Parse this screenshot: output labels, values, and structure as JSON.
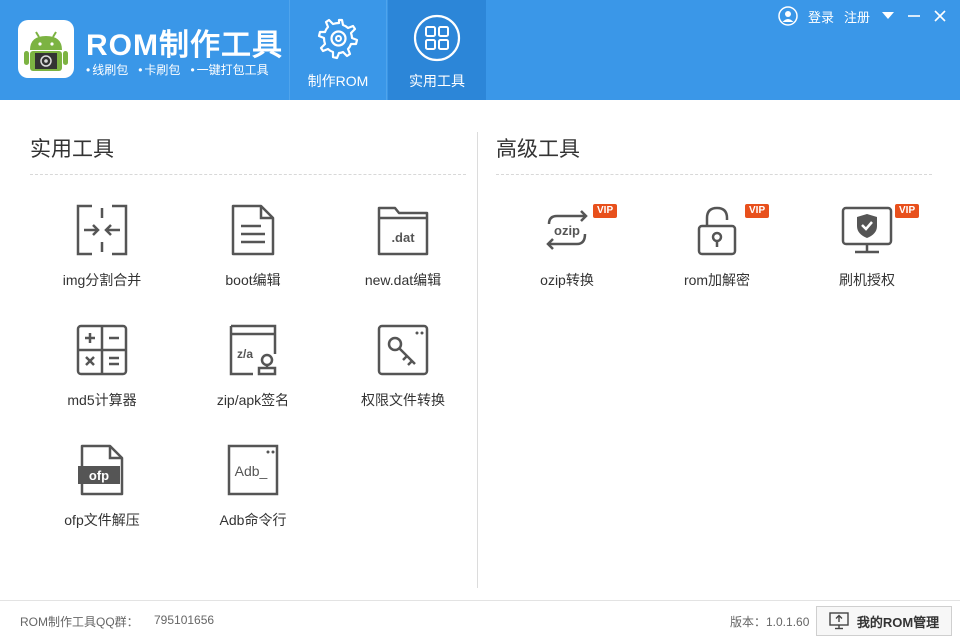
{
  "header": {
    "app_title": "ROM制作工具",
    "features": [
      "线刷包",
      "卡刷包",
      "一键打包工具"
    ],
    "tabs": [
      {
        "label": "制作ROM",
        "icon": "gear-icon"
      },
      {
        "label": "实用工具",
        "icon": "grid-icon"
      }
    ],
    "login": "登录",
    "register": "注册"
  },
  "left_section": {
    "title": "实用工具",
    "tools": [
      {
        "label": "img分割合并",
        "icon": "split-merge-icon"
      },
      {
        "label": "boot编辑",
        "icon": "document-icon"
      },
      {
        "label": "new.dat编辑",
        "icon": "dat-folder-icon",
        "icon_text": ".dat"
      },
      {
        "label": "md5计算器",
        "icon": "calculator-icon"
      },
      {
        "label": "zip/apk签名",
        "icon": "signature-icon",
        "icon_text": "z/a"
      },
      {
        "label": "权限文件转换",
        "icon": "key-icon"
      },
      {
        "label": "ofp文件解压",
        "icon": "ofp-file-icon",
        "icon_text": "ofp"
      },
      {
        "label": "Adb命令行",
        "icon": "terminal-icon",
        "icon_text": "Adb_"
      }
    ]
  },
  "right_section": {
    "title": "高级工具",
    "tools": [
      {
        "label": "ozip转换",
        "icon": "ozip-convert-icon",
        "icon_text": "ozip",
        "badge": "VIP"
      },
      {
        "label": "rom加解密",
        "icon": "lock-icon",
        "badge": "VIP"
      },
      {
        "label": "刷机授权",
        "icon": "shield-monitor-icon",
        "badge": "VIP"
      }
    ]
  },
  "footer": {
    "qq_label": "ROM制作工具QQ群：",
    "qq_number": "795101656",
    "version": "版本：1.0.1.60",
    "my_rom_button": "我的ROM管理"
  },
  "colors": {
    "header": "#3a97e8",
    "active_tab": "#2c86d8",
    "vip": "#e8501c",
    "icon": "#555555"
  }
}
